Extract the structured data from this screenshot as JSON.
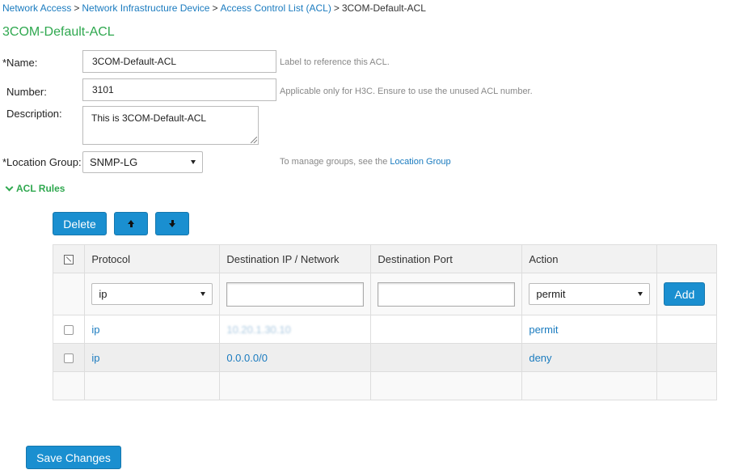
{
  "breadcrumb": {
    "items": [
      "Network Access",
      "Network Infrastructure Device",
      "Access Control List (ACL)"
    ],
    "separator": ">",
    "current": "3COM-Default-ACL"
  },
  "page_title": "3COM-Default-ACL",
  "form": {
    "name": {
      "label": "*Name:",
      "value": "3COM-Default-ACL",
      "hint": "Label to reference this ACL."
    },
    "number": {
      "label": "Number:",
      "value": "3101",
      "hint": "Applicable only for H3C. Ensure to use the unused ACL number."
    },
    "description": {
      "label": "Description:",
      "value": "This is 3COM-Default-ACL"
    },
    "location_group": {
      "label": "*Location Group:",
      "value": "SNMP-LG",
      "hint_prefix": "To manage groups, see the",
      "hint_link": "Location Group"
    }
  },
  "acl_rules": {
    "section_title": "ACL Rules",
    "toolbar": {
      "delete_label": "Delete",
      "move_up_icon": "arrow-up-icon",
      "move_down_icon": "arrow-down-icon"
    },
    "columns": [
      "Protocol",
      "Destination IP / Network",
      "Destination Port",
      "Action"
    ],
    "filter": {
      "protocol": "ip",
      "destination_ip": "",
      "destination_port": "",
      "action": "permit",
      "add_label": "Add"
    },
    "rows": [
      {
        "protocol": "ip",
        "destination_ip": "10.20.1.30.10",
        "destination_port": "",
        "action": "permit"
      },
      {
        "protocol": "ip",
        "destination_ip": "0.0.0.0/0",
        "destination_port": "",
        "action": "deny"
      }
    ]
  },
  "save_label": "Save Changes",
  "colors": {
    "accent": "#1a8fd0",
    "link": "#1a7bbf",
    "title_green": "#2fa84f"
  }
}
